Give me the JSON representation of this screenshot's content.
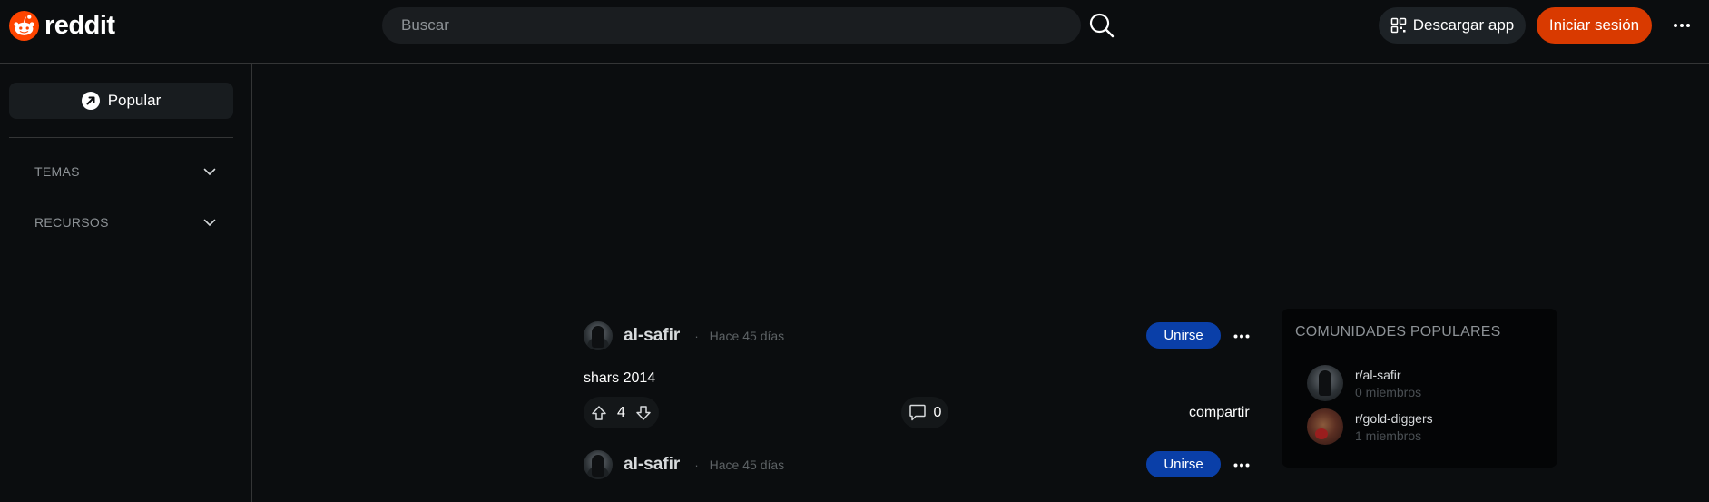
{
  "header": {
    "logo_text": "reddit",
    "search_placeholder": "Buscar",
    "download_app_label": "Descargar app",
    "login_label": "Iniciar sesión",
    "brand_color": "#ff4500",
    "login_color": "#d93a00"
  },
  "sidebar": {
    "popular_label": "Popular",
    "sections": [
      {
        "label": "TEMAS"
      },
      {
        "label": "RECURSOS"
      }
    ]
  },
  "feed": {
    "posts": [
      {
        "user": "al-safir",
        "time": "Hace 45 días",
        "join_label": "Unirse",
        "title": "shars 2014",
        "votes": "4",
        "comments": "0",
        "share_label": "compartir"
      },
      {
        "user": "al-safir",
        "time": "Hace 45 días",
        "join_label": "Unirse"
      }
    ],
    "separator": "·"
  },
  "popular_communities": {
    "title": "COMUNIDADES POPULARES",
    "items": [
      {
        "name": "r/al-safir",
        "members": "0 miembros"
      },
      {
        "name": "r/gold-diggers",
        "members": "1 miembros"
      }
    ]
  },
  "icons": [
    "reddit-logo-icon",
    "search-icon",
    "qr-grid-icon",
    "more-icon",
    "popular-arrow-icon",
    "chevron-down-icon",
    "upvote-icon",
    "downvote-icon",
    "comment-icon"
  ]
}
